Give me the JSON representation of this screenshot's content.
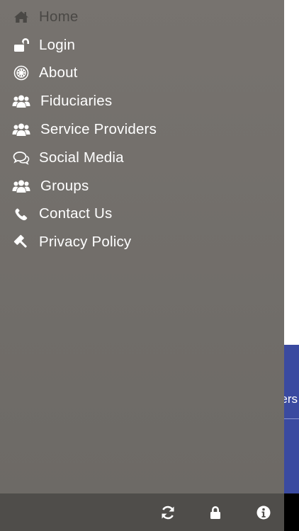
{
  "background": {
    "panel_text": "ers",
    "accent": "#3a4aa0"
  },
  "menu": {
    "items": [
      {
        "label": "Home",
        "icon": "home-icon",
        "active": true
      },
      {
        "label": "Login",
        "icon": "unlock-icon"
      },
      {
        "label": "About",
        "icon": "about-icon"
      },
      {
        "label": "Fiduciaries",
        "icon": "users-icon"
      },
      {
        "label": "Service Providers",
        "icon": "users-icon"
      },
      {
        "label": "Social Media",
        "icon": "comments-icon"
      },
      {
        "label": "Groups",
        "icon": "users-icon"
      },
      {
        "label": "Contact Us",
        "icon": "phone-icon"
      },
      {
        "label": "Privacy Policy",
        "icon": "gavel-icon"
      }
    ]
  },
  "bottom_bar": {
    "buttons": [
      "refresh-icon",
      "lock-icon",
      "info-icon"
    ]
  },
  "colors": {
    "drawer_bg": "#75716d",
    "bottom_bar_bg": "#4f4d4a",
    "active_label": "#4a4845",
    "label": "#ffffff"
  }
}
